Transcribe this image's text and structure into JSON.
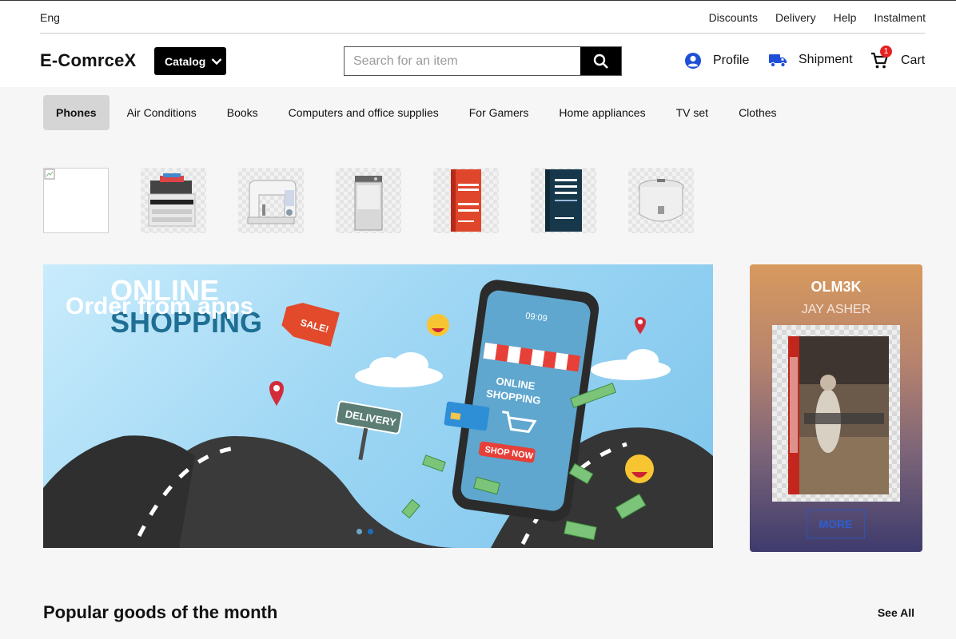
{
  "topbar": {
    "language": "Eng",
    "links": [
      "Discounts",
      "Delivery",
      "Help",
      "Instalment"
    ]
  },
  "header": {
    "logo": "E-ComrceX",
    "catalog_label": "Catalog",
    "search_placeholder": "Search for an item",
    "profile_label": "Profile",
    "shipment_label": "Shipment",
    "cart_label": "Cart",
    "cart_count": "1"
  },
  "categories": [
    {
      "label": "Phones",
      "active": true
    },
    {
      "label": "Air Conditions",
      "active": false
    },
    {
      "label": "Books",
      "active": false
    },
    {
      "label": "Computers and office supplies",
      "active": false
    },
    {
      "label": "For Gamers",
      "active": false
    },
    {
      "label": "Home appliances",
      "active": false
    },
    {
      "label": "TV set",
      "active": false
    },
    {
      "label": "Clothes",
      "active": false
    }
  ],
  "banner": {
    "caption": "Order from apps",
    "slides": 2,
    "active_slide": 2
  },
  "promo": {
    "title": "OLM3K",
    "author": "JAY ASHER",
    "button_label": "MORE"
  },
  "popular": {
    "title": "Popular goods of the month",
    "see_all_label": "See All"
  },
  "colors": {
    "accent_dark": "#000000",
    "profile_icon": "#1f4fd6",
    "cart_badge": "#e52222",
    "more_button": "#2c5fd0"
  }
}
